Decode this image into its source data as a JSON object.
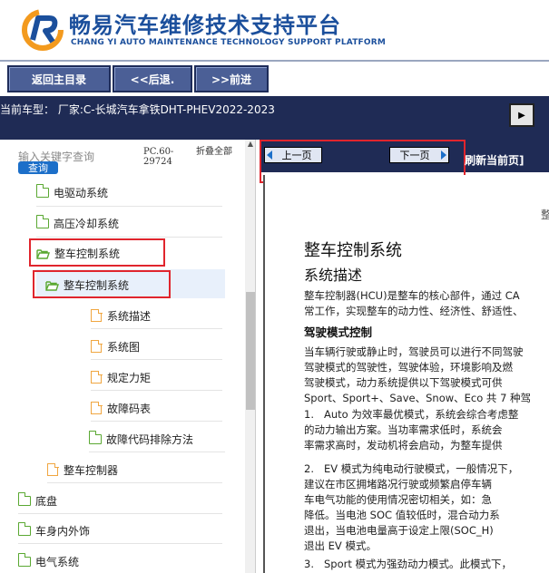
{
  "header": {
    "title": "畅易汽车维修技术支持平台",
    "subtitle": "CHANG YI AUTO MAINTENANCE TECHNOLOGY SUPPORT PLATFORM"
  },
  "nav": {
    "home": "返回主目录",
    "back": "<<后退.",
    "forward": ">>前进"
  },
  "model": {
    "text": "当前车型： 厂家:C-长城汽车拿铁DHT-PHEV2022-2023",
    "expand_symbol": "▶"
  },
  "sidebar": {
    "search_placeholder": "输入关键字查询",
    "search_button": "查询",
    "pc_code": "PC.60-29724",
    "collapse_all": "折叠全部",
    "items": [
      {
        "label": "电驱动系统"
      },
      {
        "label": "高压冷却系统"
      },
      {
        "label": "整车控制系统"
      },
      {
        "label": "整车控制系统"
      },
      {
        "label": "系统描述"
      },
      {
        "label": "系统图"
      },
      {
        "label": "规定力矩"
      },
      {
        "label": "故障码表"
      },
      {
        "label": "故障代码排除方法"
      },
      {
        "label": "整车控制器"
      },
      {
        "label": "底盘"
      },
      {
        "label": "车身内外饰"
      },
      {
        "label": "电气系统"
      }
    ]
  },
  "pager": {
    "prev": "上一页",
    "next": "下一页",
    "refresh": "刷新当前页]"
  },
  "document": {
    "page_marker": "整",
    "title": "整车控制系统",
    "section": "系统描述",
    "intro": [
      "整车控制器(HCU)是整车的核心部件，通过 CA",
      "常工作，实现整车的动力性、经济性、舒适性、"
    ],
    "mode_heading": "驾驶模式控制",
    "mode_para": [
      "当车辆行驶或静止时，驾驶员可以进行不同驾驶",
      "驾驶模式的驾驶性，驾驶体验，环境影响及燃",
      "驾驶模式，动力系统提供以下驾驶模式可供",
      "Sport、Sport+、Save、Snow、Eco 共 7 种驾"
    ],
    "list": [
      {
        "num": "1.",
        "lines": [
          "Auto 为效率最优模式，系统会综合考虑整",
          "的动力输出方案。当功率需求低时，系统会",
          "率需求高时，发动机将会启动，为整车提供"
        ]
      },
      {
        "num": "2.",
        "lines": [
          "EV 模式为纯电动行驶模式，一般情况下，",
          "建议在市区拥堵路况行驶或频繁启停车辆",
          "车电气功能的使用情况密切相关，如：急",
          "降低。当电池 SOC 值较低时，混合动力系",
          "退出，当电池电量高于设定上限(SOC_H)",
          "退出 EV 模式。"
        ]
      },
      {
        "num": "3.",
        "lines": [
          "Sport 模式为强劲动力模式。此模式下，"
        ]
      }
    ]
  },
  "colors": {
    "brand": "#1b4f9c",
    "navy": "#1f2b55",
    "nav_button": "#4b5f96",
    "highlight": "#e0252d",
    "folder": "#5aa832",
    "doc_icon": "#f0a640"
  }
}
